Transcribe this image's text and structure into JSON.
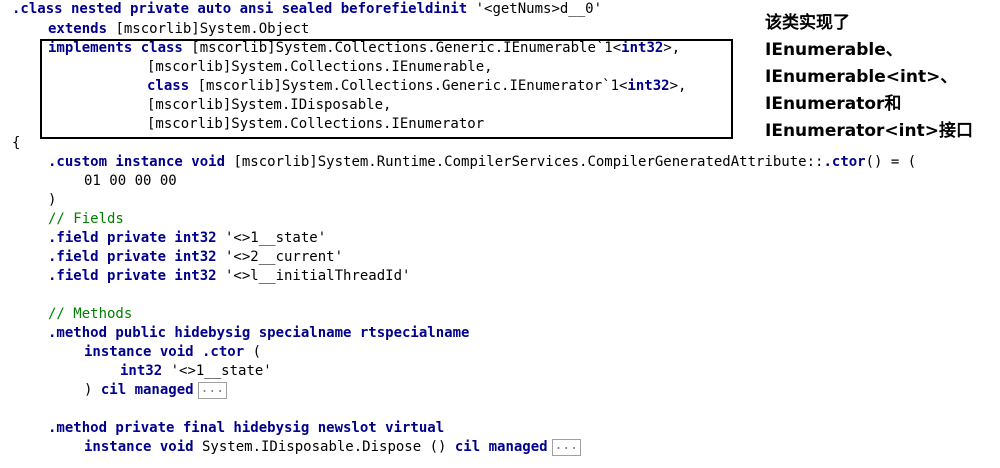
{
  "code": {
    "l1": {
      "k": ".class nested private auto ansi sealed beforefieldinit",
      "s": " '<getNums>d__0'"
    },
    "l2": {
      "k": "extends",
      "t": " [mscorlib]System.Object"
    },
    "l3": {
      "k1": "implements class",
      "t1": " [mscorlib]System.Collections.Generic.IEnumerable`1<",
      "k2": "int32",
      "t2": ">,"
    },
    "l4": {
      "t": "[mscorlib]System.Collections.IEnumerable,"
    },
    "l5": {
      "k1": "class",
      "t1": " [mscorlib]System.Collections.Generic.IEnumerator`1<",
      "k2": "int32",
      "t2": ">,"
    },
    "l6": {
      "t": "[mscorlib]System.IDisposable,"
    },
    "l7": {
      "t": "[mscorlib]System.Collections.IEnumerator"
    },
    "l8": {
      "t": "{"
    },
    "l9": {
      "k1": ".custom instance void",
      "t1": " [mscorlib]System.Runtime.CompilerServices.CompilerGeneratedAttribute::",
      "k2": ".ctor",
      "t2": "() = ("
    },
    "l10": {
      "t": "01 00 00 00"
    },
    "l11": {
      "t": ")"
    },
    "l12": {
      "c": "// Fields"
    },
    "l13": {
      "k": ".field private int32",
      "s": " '<>1__state'"
    },
    "l14": {
      "k": ".field private int32",
      "s": " '<>2__current'"
    },
    "l15": {
      "k": ".field private int32",
      "s": " '<>l__initialThreadId'"
    },
    "l16": {
      "c": "// Methods"
    },
    "l17": {
      "k": ".method public hidebysig specialname rtspecialname"
    },
    "l18": {
      "k": "instance void .ctor",
      "t": " ("
    },
    "l19": {
      "k": "int32",
      "s": " '<>1__state'"
    },
    "l20": {
      "t": ") ",
      "k": "cil managed",
      "btn": "..."
    },
    "l21": {
      "k": ".method private final hidebysig newslot virtual"
    },
    "l22": {
      "k1": "instance void",
      "t1": " System.IDisposable.Dispose () ",
      "k2": "cil managed",
      "btn": "..."
    }
  },
  "annotation": {
    "line1": "该类实现了",
    "line2": "IEnumerable、",
    "line3": "IEnumerable<int>、",
    "line4": "IEnumerator和",
    "line5": "IEnumerator<int>接口"
  }
}
